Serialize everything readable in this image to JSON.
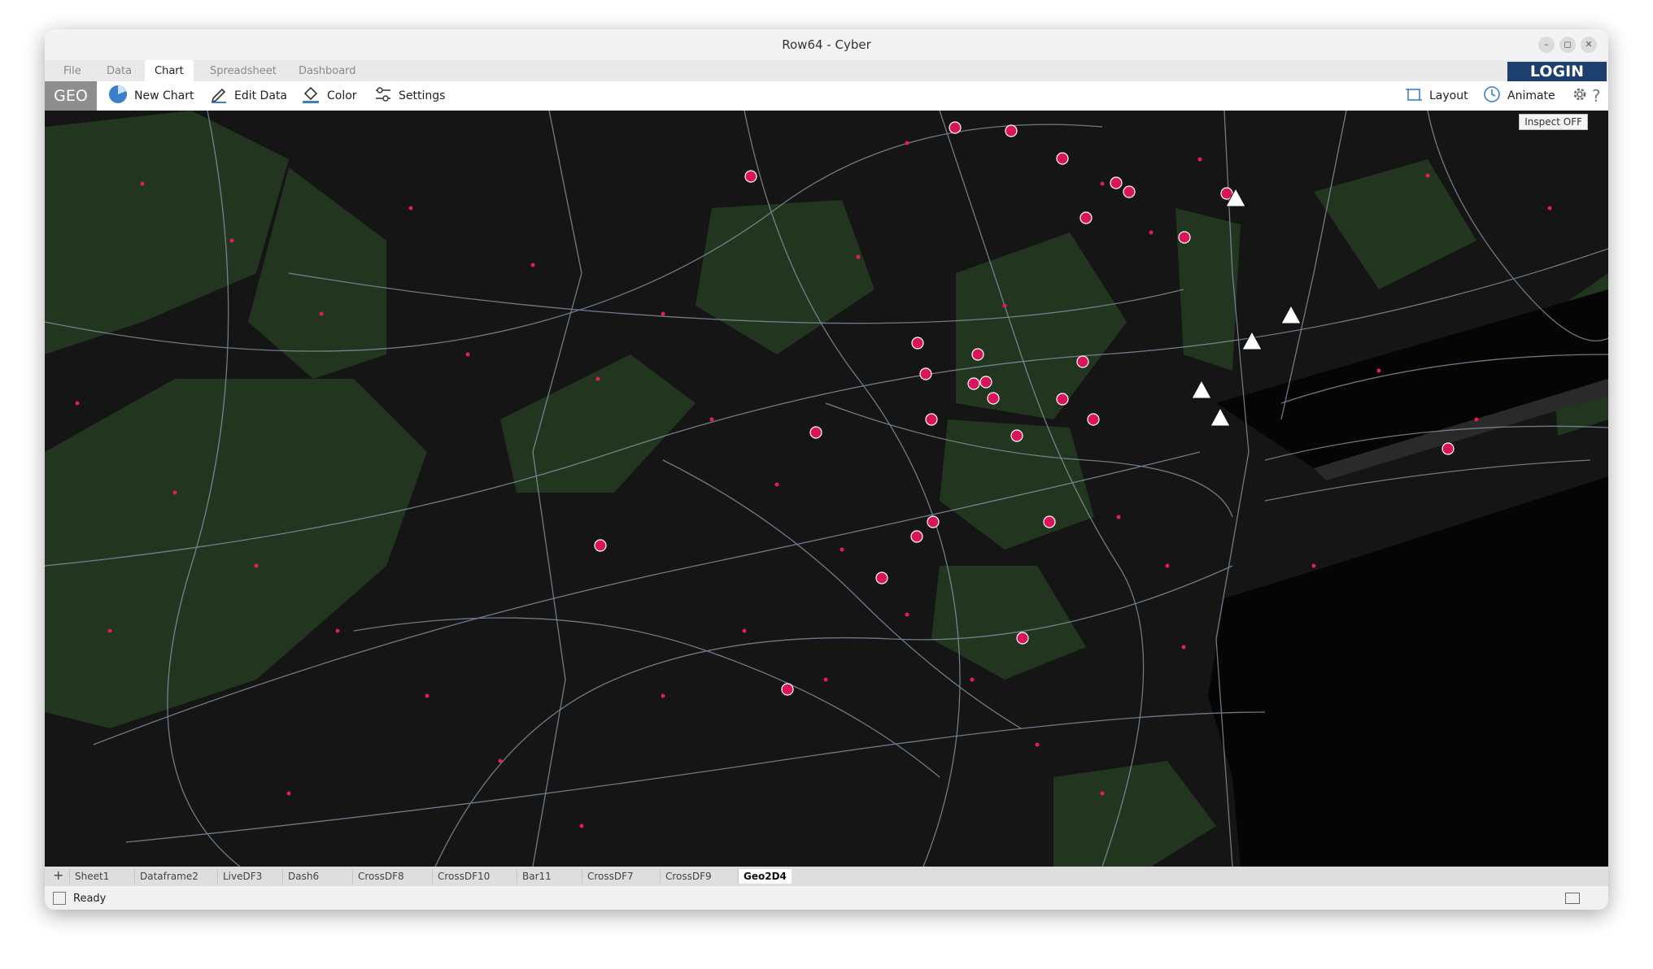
{
  "window": {
    "title": "Row64 - Cyber",
    "minimize": "–",
    "maximize": "◻",
    "close": "✕"
  },
  "menu": {
    "tabs": [
      "File",
      "Data",
      "Chart",
      "Spreadsheet",
      "Dashboard"
    ],
    "active": "Chart",
    "login": "LOGIN"
  },
  "toolbar": {
    "geo": "GEO",
    "new_chart": "New Chart",
    "edit_data": "Edit Data",
    "color": "Color",
    "settings": "Settings",
    "layout": "Layout",
    "animate": "Animate"
  },
  "map": {
    "inspect": "Inspect OFF",
    "colors": {
      "background": "#151515",
      "forest": "#22361f",
      "roads": "#8c9cb0",
      "dot": "#e31b5a",
      "marker": "#d9145a"
    }
  },
  "sheets": {
    "add": "+",
    "items": [
      "Sheet1",
      "Dataframe2",
      "LiveDF3",
      "Dash6",
      "CrossDF8",
      "CrossDF10",
      "Bar11",
      "CrossDF7",
      "CrossDF9",
      "Geo2D4"
    ],
    "active": "Geo2D4"
  },
  "status": {
    "text": "Ready"
  }
}
